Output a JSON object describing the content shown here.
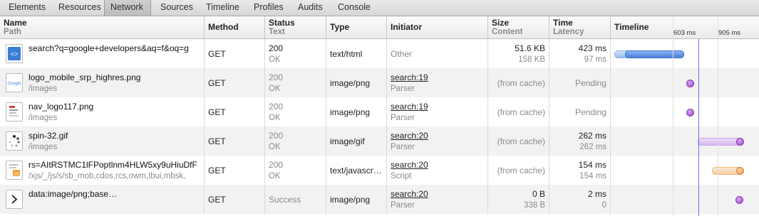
{
  "tabs": [
    "Elements",
    "Resources",
    "Network",
    "Sources",
    "Timeline",
    "Profiles",
    "Audits",
    "Console"
  ],
  "active_tab": "Network",
  "columns": {
    "name": {
      "main": "Name",
      "sub": "Path"
    },
    "method": {
      "main": "Method"
    },
    "status": {
      "main": "Status",
      "sub": "Text"
    },
    "type": {
      "main": "Type"
    },
    "initiator": {
      "main": "Initiator"
    },
    "size": {
      "main": "Size",
      "sub": "Content"
    },
    "time": {
      "main": "Time",
      "sub": "Latency"
    },
    "timeline": {
      "main": "Timeline",
      "mark1": "603 ms",
      "mark2": "905 ms"
    }
  },
  "rows": [
    {
      "name": "search?q=google+developers&aq=f&oq=g",
      "path": "",
      "icon": "html-document-icon",
      "method": "GET",
      "status": "200",
      "status_text": "OK",
      "type": "text/html",
      "initiator": "Other",
      "initiator_sub": "",
      "size": "51.6 KB",
      "content": "158 KB",
      "time": "423 ms",
      "latency": "97 ms",
      "timeline_fill": "blue"
    },
    {
      "name": "logo_mobile_srp_highres.png",
      "path": "/images",
      "icon": "image-thumbnail-icon",
      "method": "GET",
      "status": "200",
      "status_text": "OK",
      "type": "image/png",
      "initiator": "search:19",
      "initiator_sub": "Parser",
      "size_single": "(from cache)",
      "time_single": "Pending",
      "timeline_fill": "purple"
    },
    {
      "name": "nav_logo117.png",
      "path": "/images",
      "icon": "image-thumbnail-icon",
      "method": "GET",
      "status": "200",
      "status_text": "OK",
      "type": "image/png",
      "initiator": "search:19",
      "initiator_sub": "Parser",
      "size_single": "(from cache)",
      "time_single": "Pending",
      "timeline_fill": "purple"
    },
    {
      "name": "spin-32.gif",
      "path": "/images",
      "icon": "spinner-thumbnail-icon",
      "method": "GET",
      "status": "200",
      "status_text": "OK",
      "type": "image/gif",
      "initiator": "search:20",
      "initiator_sub": "Parser",
      "size_single": "(from cache)",
      "time": "262 ms",
      "latency": "262 ms",
      "timeline_fill": "purple"
    },
    {
      "name": "rs=AItRSTMC1lFPoptlnm4HLW5xy9uHiuDfF",
      "path": "/xjs/_/js/s/sb_mob,cdos,rcs,owm,tbui,mbsk,",
      "icon": "javascript-file-icon",
      "method": "GET",
      "status": "200",
      "status_text": "OK",
      "type": "text/javascr…",
      "initiator": "search:20",
      "initiator_sub": "Script",
      "size_single": "(from cache)",
      "time": "154 ms",
      "latency": "154 ms",
      "timeline_fill": "orange"
    },
    {
      "name": "data:image/png;base…",
      "path": "",
      "icon": "chevron-right-icon",
      "method": "GET",
      "status_single": "Success",
      "type": "image/png",
      "initiator": "search:20",
      "initiator_sub": "Parser",
      "size": "0 B",
      "content": "338 B",
      "time": "2 ms",
      "latency": "0",
      "timeline_fill": "purple"
    }
  ],
  "colors": {
    "blue": "#5b8fe0",
    "purple": "#a455d0",
    "orange": "#f2a95c",
    "divider": "#6e6ef0"
  }
}
